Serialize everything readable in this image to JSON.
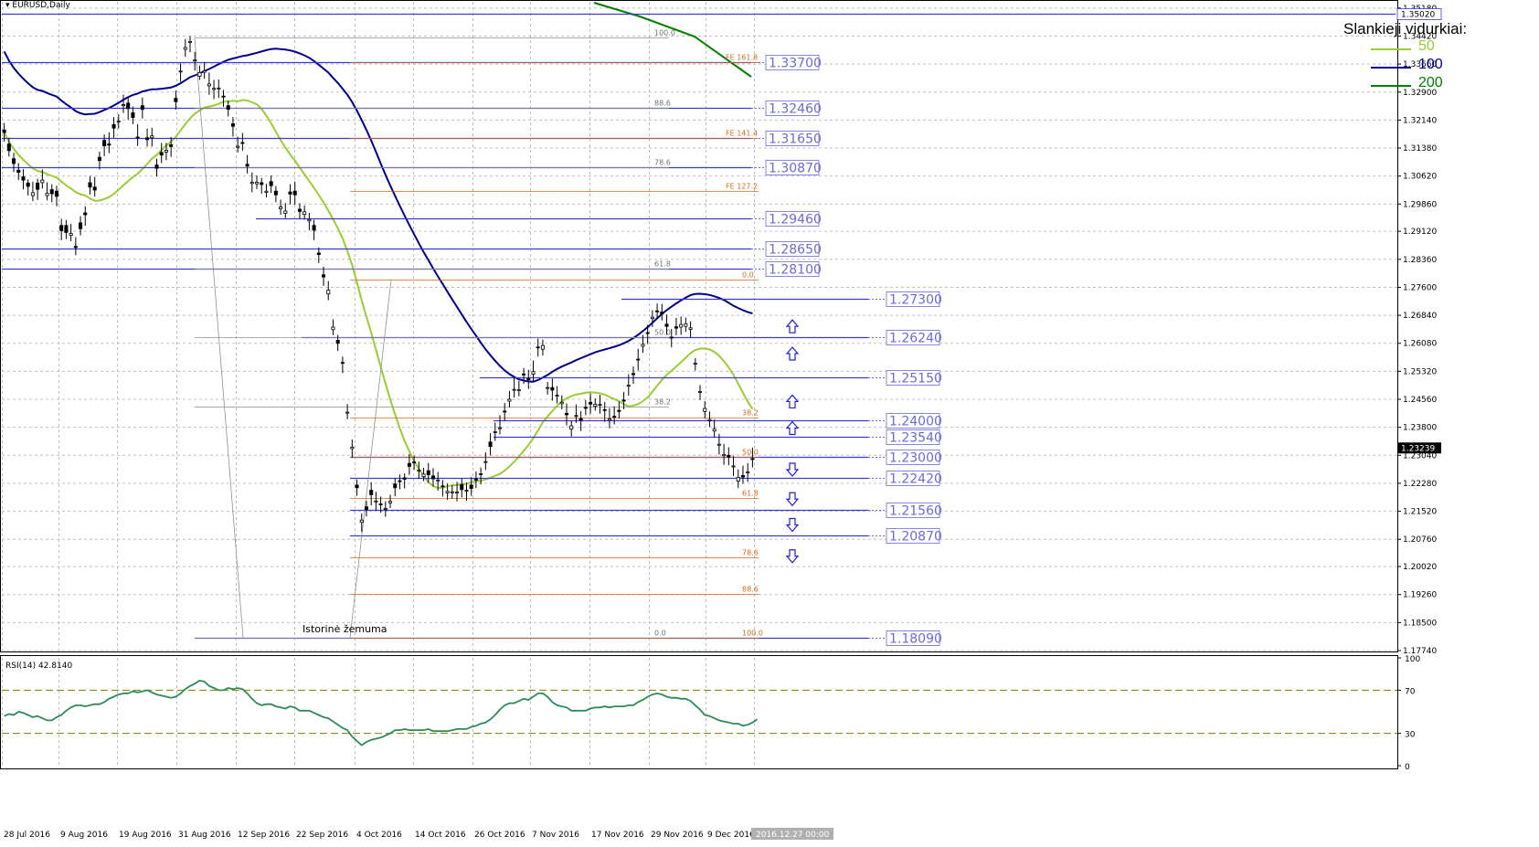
{
  "symbol_label": "EURUSD,Daily",
  "legend": {
    "title": "Slankieji vidurkiai:",
    "items": [
      {
        "label": "50",
        "color": "#9acd32"
      },
      {
        "label": "100",
        "color": "#00008b"
      },
      {
        "label": "200",
        "color": "#008000"
      }
    ]
  },
  "colors": {
    "bull_candle": "#ffffff",
    "bear_candle": "#000000",
    "level_line": "#3b3bd4",
    "level_text": "#6a6ad8",
    "fib_line": "#d2691e",
    "fib_text": "#d2691e",
    "grid": "#c0c0c0",
    "rsi_line": "#2e8b57",
    "rsi_level": "#808000",
    "arrow": "#2020d0"
  },
  "chart_data": [
    {
      "type": "candlestick",
      "title": "",
      "ylim": [
        1.1774,
        1.3525
      ],
      "y_ticks": [
        "1.35180",
        "1.34420",
        "1.33660",
        "1.32900",
        "1.32140",
        "1.31380",
        "1.30620",
        "1.29860",
        "1.29120",
        "1.28360",
        "1.27600",
        "1.26840",
        "1.26080",
        "1.25320",
        "1.24560",
        "1.23800",
        "1.23040",
        "1.22280",
        "1.21520",
        "1.20760",
        "1.20020",
        "1.19260",
        "1.18500",
        "1.17740"
      ],
      "x_labels": [
        "28 Jul 2016",
        "9 Aug 2016",
        "19 Aug 2016",
        "31 Aug 2016",
        "12 Sep 2016",
        "22 Sep 2016",
        "4 Oct 2016",
        "14 Oct 2016",
        "26 Oct 2016",
        "7 Nov 2016",
        "17 Nov 2016",
        "29 Nov 2016",
        "9 Dec 2016",
        "2016.12.27 00:00"
      ],
      "current_price": "1.23239",
      "candles_close": [
        1.318,
        1.3131,
        1.3096,
        1.3072,
        1.3051,
        1.3034,
        1.3017,
        1.3026,
        1.3051,
        1.3015,
        1.3014,
        1.3007,
        1.2914,
        1.2909,
        1.2906,
        1.2868,
        1.2919,
        1.2957,
        1.3032,
        1.3024,
        1.3104,
        1.3144,
        1.3146,
        1.3192,
        1.3211,
        1.3256,
        1.3245,
        1.3221,
        1.3167,
        1.3243,
        1.3161,
        1.3171,
        1.3083,
        1.3119,
        1.3132,
        1.3142,
        1.3264,
        1.3347,
        1.3411,
        1.3427,
        1.3377,
        1.3343,
        1.3348,
        1.3312,
        1.33,
        1.3301,
        1.3278,
        1.3243,
        1.3197,
        1.3143,
        1.3151,
        1.3089,
        1.3045,
        1.3045,
        1.3039,
        1.3021,
        1.3036,
        1.3011,
        1.2978,
        1.2967,
        1.3013,
        1.3011,
        1.2966,
        1.2965,
        1.2944,
        1.2915,
        1.2849,
        1.2788,
        1.2752,
        1.2652,
        1.2608,
        1.2555,
        1.2421,
        1.2326,
        1.2216,
        1.2128,
        1.2157,
        1.2197,
        1.218,
        1.217,
        1.216,
        1.2179,
        1.2216,
        1.2233,
        1.2239,
        1.2274,
        1.2285,
        1.2264,
        1.2253,
        1.2251,
        1.224,
        1.2237,
        1.222,
        1.2206,
        1.2205,
        1.2204,
        1.2211,
        1.2209,
        1.2214,
        1.2237,
        1.2253,
        1.2287,
        1.2328,
        1.2368,
        1.2379,
        1.2422,
        1.2456,
        1.2483,
        1.2482,
        1.2522,
        1.2509,
        1.2531,
        1.2597,
        1.2602,
        1.2488,
        1.2481,
        1.2467,
        1.2448,
        1.2414,
        1.2384,
        1.2412,
        1.2399,
        1.2433,
        1.2443,
        1.2443,
        1.2442,
        1.2426,
        1.2403,
        1.2409,
        1.2423,
        1.2451,
        1.2494,
        1.2523,
        1.2564,
        1.2605,
        1.2636,
        1.2679,
        1.2695,
        1.2687,
        1.2654,
        1.2622,
        1.2649,
        1.2659,
        1.2661,
        1.265,
        1.2554,
        1.2477,
        1.2431,
        1.2401,
        1.2375,
        1.2334,
        1.2306,
        1.2299,
        1.2275,
        1.2244,
        1.2245,
        1.2259,
        1.2294
      ],
      "candles_high": [
        1.3206,
        1.3166,
        1.3125,
        1.3097,
        1.3081,
        1.3053,
        1.3047,
        1.3055,
        1.308,
        1.3045,
        1.304,
        1.3036,
        1.2946,
        1.2943,
        1.2932,
        1.2896,
        1.2953,
        1.298,
        1.3062,
        1.306,
        1.3128,
        1.3175,
        1.3181,
        1.3222,
        1.323,
        1.3283,
        1.3278,
        1.3251,
        1.3203,
        1.3275,
        1.3191,
        1.3193,
        1.3109,
        1.3152,
        1.3152,
        1.3168,
        1.3294,
        1.3368,
        1.3434,
        1.3442,
        1.3399,
        1.3362,
        1.3372,
        1.3343,
        1.3323,
        1.3324,
        1.3296,
        1.3267,
        1.3222,
        1.3169,
        1.3179,
        1.3119,
        1.3072,
        1.3064,
        1.3057,
        1.3041,
        1.3064,
        1.3035,
        1.2998,
        1.2989,
        1.304,
        1.3047,
        1.2988,
        1.2982,
        1.2962,
        1.2943,
        1.2868,
        1.2816,
        1.2777,
        1.2673,
        1.2631,
        1.2572,
        1.2443,
        1.2347,
        1.2238,
        1.2146,
        1.218,
        1.2231,
        1.2205,
        1.2192,
        1.2179,
        1.2197,
        1.2242,
        1.2252,
        1.2255,
        1.2307,
        1.2303,
        1.2287,
        1.227,
        1.2283,
        1.2269,
        1.2259,
        1.2237,
        1.2227,
        1.2223,
        1.2232,
        1.2241,
        1.223,
        1.2245,
        1.226,
        1.2271,
        1.2312,
        1.2364,
        1.2393,
        1.2413,
        1.2446,
        1.2479,
        1.2517,
        1.2506,
        1.2541,
        1.2536,
        1.2561,
        1.2621,
        1.2618,
        1.2503,
        1.2512,
        1.2492,
        1.2467,
        1.2445,
        1.2398,
        1.2442,
        1.2424,
        1.2454,
        1.2472,
        1.2458,
        1.2468,
        1.2449,
        1.2432,
        1.2437,
        1.245,
        1.2476,
        1.2524,
        1.2545,
        1.2593,
        1.2631,
        1.2658,
        1.2698,
        1.2716,
        1.2715,
        1.2686,
        1.2647,
        1.2677,
        1.2681,
        1.2678,
        1.2668,
        1.2568,
        1.2495,
        1.2451,
        1.2423,
        1.2401,
        1.2362,
        1.2335,
        1.2326,
        1.2302,
        1.2266,
        1.2276,
        1.2283,
        1.2325
      ],
      "candles_low": [
        1.3155,
        1.3115,
        1.3073,
        1.3051,
        1.3026,
        1.3009,
        1.2994,
        1.2997,
        1.3028,
        1.2996,
        1.2991,
        1.298,
        1.2888,
        1.2891,
        1.2885,
        1.2847,
        1.2901,
        1.2927,
        1.3012,
        1.3006,
        1.308,
        1.3116,
        1.3124,
        1.3166,
        1.3191,
        1.3233,
        1.3215,
        1.3203,
        1.3144,
        1.3218,
        1.3142,
        1.3142,
        1.3061,
        1.3097,
        1.3105,
        1.3114,
        1.3242,
        1.3318,
        1.3386,
        1.3398,
        1.3348,
        1.3323,
        1.3326,
        1.3283,
        1.3271,
        1.3274,
        1.325,
        1.3224,
        1.3169,
        1.3126,
        1.3131,
        1.3069,
        1.3018,
        1.3027,
        1.3014,
        1.3004,
        1.3016,
        1.2991,
        1.2957,
        1.2948,
        1.2985,
        1.2984,
        1.2947,
        1.2944,
        1.2915,
        1.2888,
        1.2826,
        1.2764,
        1.2725,
        1.263,
        1.2587,
        1.2527,
        1.2402,
        1.2297,
        1.2194,
        1.2096,
        1.2138,
        1.2168,
        1.2155,
        1.2148,
        1.2137,
        1.2161,
        1.2193,
        1.2212,
        1.2214,
        1.2251,
        1.2265,
        1.224,
        1.2234,
        1.2229,
        1.2219,
        1.2208,
        1.2192,
        1.2183,
        1.2186,
        1.2179,
        1.219,
        1.2181,
        1.2194,
        1.2215,
        1.2225,
        1.2264,
        1.2304,
        1.2343,
        1.2361,
        1.2398,
        1.2434,
        1.2461,
        1.2464,
        1.2498,
        1.2484,
        1.2506,
        1.2572,
        1.2575,
        1.2469,
        1.2452,
        1.2445,
        1.2429,
        1.2385,
        1.2355,
        1.2392,
        1.237,
        1.2413,
        1.2417,
        1.2425,
        1.2417,
        1.2395,
        1.2377,
        1.2388,
        1.2404,
        1.2429,
        1.2466,
        1.2498,
        1.2534,
        1.2582,
        1.2606,
        1.2652,
        1.2675,
        1.267,
        1.2631,
        1.2597,
        1.263,
        1.2631,
        1.2639,
        1.2623,
        1.2534,
        1.2454,
        1.2404,
        1.2381,
        1.2353,
        1.2306,
        1.2278,
        1.2277,
        1.2248,
        1.2215,
        1.2227,
        1.2232,
        1.2271
      ],
      "candles_open": [
        1.3187,
        1.3149,
        1.3109,
        1.3078,
        1.306,
        1.3043,
        1.3009,
        1.3043,
        1.3044,
        1.3009,
        1.3025,
        1.3021,
        1.2928,
        1.2928,
        1.2901,
        1.2871,
        1.2935,
        1.2962,
        1.3044,
        1.3032,
        1.3113,
        1.3159,
        1.3149,
        1.3202,
        1.3211,
        1.3253,
        1.326,
        1.3234,
        1.3168,
        1.3253,
        1.3166,
        1.3166,
        1.3092,
        1.3126,
        1.3127,
        1.3147,
        1.3273,
        1.3345,
        1.3406,
        1.3425,
        1.3377,
        1.3333,
        1.3344,
        1.3307,
        1.3297,
        1.3299,
        1.3279,
        1.3253,
        1.3204,
        1.314,
        1.3153,
        1.3094,
        1.3042,
        1.3041,
        1.3044,
        1.3018,
        1.3047,
        1.3021,
        1.2973,
        1.2961,
        1.3019,
        1.3021,
        1.2972,
        1.2958,
        1.294,
        1.2928,
        1.2853,
        1.2794,
        1.2742,
        1.2645,
        1.2616,
        1.2556,
        1.2421,
        1.2322,
        1.2223,
        1.2122,
        1.2164,
        1.2209,
        1.218,
        1.2172,
        1.2159,
        1.2175,
        1.2226,
        1.2235,
        1.2243,
        1.2282,
        1.2286,
        1.2262,
        1.2246,
        1.2262,
        1.2248,
        1.2236,
        1.2221,
        1.2202,
        1.2204,
        1.2202,
        1.2225,
        1.2209,
        1.2223,
        1.2239,
        1.2254,
        1.2287,
        1.234,
        1.2368,
        1.2379,
        1.2424,
        1.2451,
        1.2481,
        1.2482,
        1.2525,
        1.2512,
        1.2524,
        1.2598,
        1.2592,
        1.2488,
        1.2488,
        1.2466,
        1.2444,
        1.2418,
        1.2375,
        1.2411,
        1.2404,
        1.2434,
        1.2448,
        1.2437,
        1.244,
        1.2428,
        1.2399,
        1.241,
        1.2426,
        1.2454,
        1.2493,
        1.2526,
        1.2565,
        1.26,
        1.2637,
        1.2675,
        1.2696,
        1.2693,
        1.266,
        1.2625,
        1.2653,
        1.2652,
        1.2654,
        1.2646,
        1.2554,
        1.2476,
        1.2423,
        1.2398,
        1.237,
        1.2333,
        1.2303,
        1.2304,
        1.2274,
        1.2234,
        1.2249,
        1.2258,
        1.2295
      ],
      "horizontal_levels": [
        {
          "value": 1.3502,
          "label": "1.35020"
        },
        {
          "value": 1.337,
          "label": "1.33700"
        },
        {
          "value": 1.3246,
          "label": "1.32460"
        },
        {
          "value": 1.3165,
          "label": "1.31650"
        },
        {
          "value": 1.3087,
          "label": "1.30870"
        },
        {
          "value": 1.2946,
          "label": "1.29460"
        },
        {
          "value": 1.2865,
          "label": "1.28650"
        },
        {
          "value": 1.281,
          "label": "1.28100"
        },
        {
          "value": 1.273,
          "label": "1.27300"
        },
        {
          "value": 1.2624,
          "label": "1.26240"
        },
        {
          "value": 1.2515,
          "label": "1.25150"
        },
        {
          "value": 1.24,
          "label": "1.24000"
        },
        {
          "value": 1.2354,
          "label": "1.23540"
        },
        {
          "value": 1.23,
          "label": "1.23000"
        },
        {
          "value": 1.2242,
          "label": "1.22420"
        },
        {
          "value": 1.2156,
          "label": "1.21560"
        },
        {
          "value": 1.2087,
          "label": "1.20870"
        },
        {
          "value": 1.1809,
          "label": "1.18090"
        }
      ],
      "fib_retracement_labels": [
        "100.0",
        "88.6",
        "78.6",
        "61.8",
        "50.0",
        "38.2",
        "0.0"
      ],
      "fib_expansion_labels": [
        "FE 161.8",
        "FE 141.4",
        "FE 127.2",
        "0.0",
        "38.2",
        "50.0",
        "61.8",
        "78.6",
        "88.6",
        "100.0"
      ],
      "annotation": "Istorinė žemuma",
      "arrows": {
        "up": 4,
        "down": 4
      }
    },
    {
      "type": "line",
      "title": "RSI(14) 42.8140",
      "ylim": [
        0,
        100
      ],
      "y_ticks": [
        "100",
        "70",
        "30",
        "0"
      ],
      "levels": [
        70,
        30
      ],
      "values": [
        46,
        48,
        47,
        50,
        49,
        47,
        45,
        46,
        44,
        42,
        42,
        45,
        47,
        51,
        54,
        56,
        56,
        55,
        56,
        57,
        57,
        59,
        62,
        64,
        66,
        67,
        67,
        69,
        68,
        69,
        70,
        68,
        66,
        65,
        64,
        63,
        64,
        67,
        71,
        74,
        76,
        79,
        78,
        74,
        72,
        70,
        70,
        72,
        71,
        72,
        71,
        67,
        62,
        58,
        56,
        57,
        57,
        55,
        54,
        53,
        55,
        54,
        51,
        51,
        51,
        49,
        47,
        45,
        44,
        41,
        38,
        35,
        33,
        27,
        23,
        19,
        22,
        24,
        25,
        26,
        28,
        30,
        33,
        33,
        34,
        33,
        33,
        33,
        33,
        34,
        32,
        32,
        32,
        32,
        33,
        34,
        34,
        34,
        36,
        37,
        39,
        40,
        43,
        47,
        52,
        56,
        58,
        58,
        60,
        62,
        61,
        64,
        67,
        67,
        64,
        59,
        56,
        55,
        54,
        51,
        51,
        51,
        51,
        53,
        54,
        54,
        55,
        54,
        55,
        55,
        55,
        56,
        56,
        59,
        61,
        64,
        66,
        67,
        66,
        64,
        63,
        63,
        62,
        62,
        60,
        56,
        52,
        47,
        46,
        44,
        42,
        41,
        40,
        39,
        39,
        37,
        38,
        40,
        43
      ]
    }
  ]
}
